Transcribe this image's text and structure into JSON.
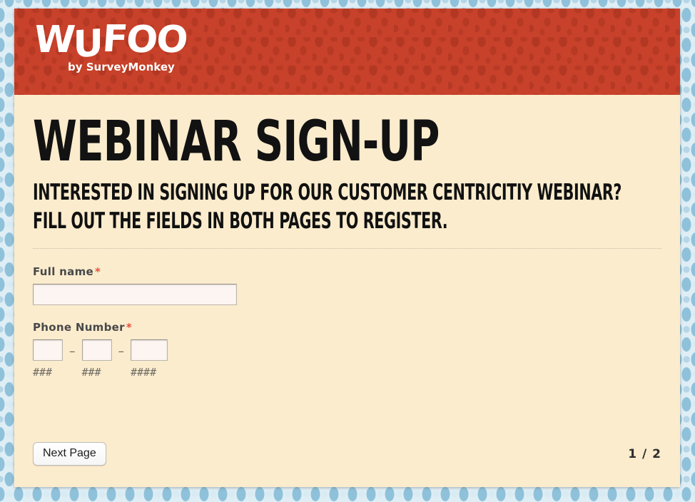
{
  "theme": {
    "page_bg_color": "#dfeef5",
    "pattern_color": "#8fc2da",
    "header_color": "#c8412a",
    "form_bg_color": "#fbeccd",
    "input_bg_color": "#fdf5f1",
    "label_color": "#48494a",
    "required_color": "#e8503a"
  },
  "header": {
    "logo_w": "W",
    "logo_u": "U",
    "logo_f": "F",
    "logo_oo": "OO",
    "logo_text": "WUFOO",
    "tagline": "by SurveyMonkey"
  },
  "form": {
    "title": "WEBINAR SIGN-UP",
    "subtitle_line1": "INTERESTED IN SIGNING UP FOR OUR CUSTOMER CENTRICITIY WEBINAR?",
    "subtitle_line2": "FILL OUT THE FIELDS IN BOTH PAGES TO REGISTER.",
    "fields": [
      {
        "name": "full-name",
        "label": "Full name",
        "required_marker": "*",
        "value": "",
        "placeholder": ""
      },
      {
        "name": "phone-number",
        "label": "Phone Number",
        "required_marker": "*",
        "separator": "–",
        "parts": [
          {
            "name": "area-code",
            "value": "",
            "placeholder": "",
            "hint": "###"
          },
          {
            "name": "prefix",
            "value": "",
            "placeholder": "",
            "hint": "###"
          },
          {
            "name": "line-number",
            "value": "",
            "placeholder": "",
            "hint": "####"
          }
        ]
      }
    ]
  },
  "footer": {
    "next_button_label": "Next Page",
    "page_indicator": "1 / 2",
    "current_page": 1,
    "total_pages": 2
  }
}
